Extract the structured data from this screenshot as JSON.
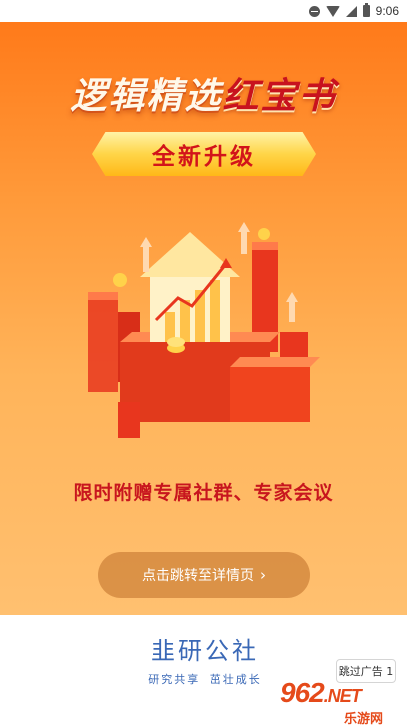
{
  "status_bar": {
    "time": "9:06",
    "icons": [
      "do-not-disturb-icon",
      "wifi-icon",
      "signal-icon",
      "battery-icon"
    ]
  },
  "ad": {
    "headline_white": "逻辑精选",
    "headline_red": "红宝书",
    "upgrade_badge": "全新升级",
    "promo_text": "限时附赠专属社群、专家会议",
    "detail_button": "点击跳转至详情页",
    "detail_chevron": "›"
  },
  "brand": {
    "name": "韭研公社",
    "slogan": "研究共享 茁壮成长"
  },
  "skip_button": "跳过广告 1",
  "watermark": {
    "logo_number": "962",
    "logo_suffix": ".NET",
    "site_name": "乐游网"
  },
  "colors": {
    "banner_top": "#ff7a1a",
    "banner_bottom": "#ffc070",
    "accent_red": "#c8161e",
    "brand_blue": "#3a68b6",
    "ribbon_gold": "#ffd548"
  }
}
